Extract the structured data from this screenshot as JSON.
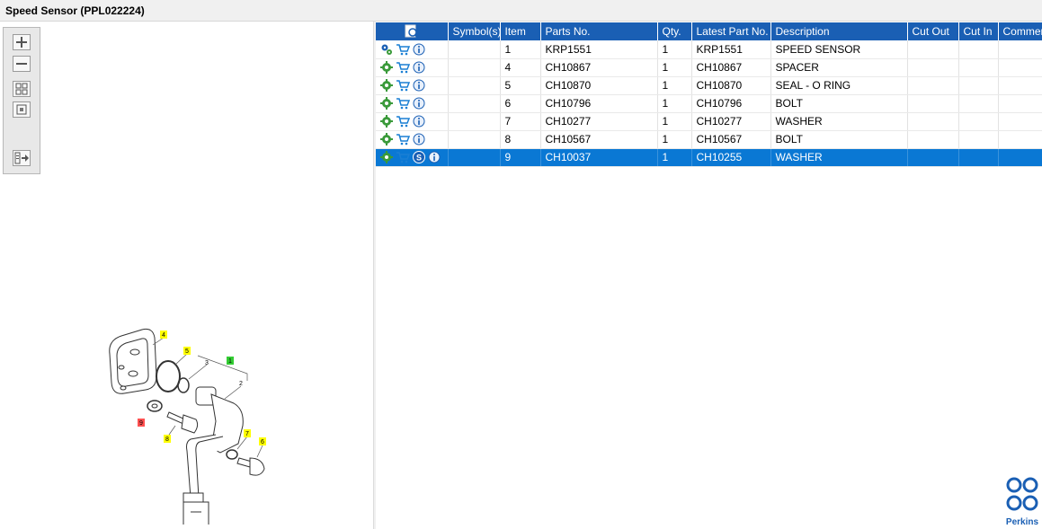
{
  "window": {
    "title": "Speed Sensor (PPL022224)"
  },
  "toolbar": {
    "tools": [
      {
        "name": "zoom-in-icon"
      },
      {
        "name": "zoom-out-icon"
      },
      {
        "name": "fit-all-icon"
      },
      {
        "name": "actual-size-icon"
      },
      {
        "name": "export-icon"
      }
    ]
  },
  "drawing": {
    "callouts": [
      {
        "label": "4",
        "color": "#ffff00"
      },
      {
        "label": "5",
        "color": "#ffff00"
      },
      {
        "label": "3",
        "color": ""
      },
      {
        "label": "1",
        "color": "#33cc33"
      },
      {
        "label": "2",
        "color": ""
      },
      {
        "label": "9",
        "color": "#ff5050"
      },
      {
        "label": "8",
        "color": "#ffff00"
      },
      {
        "label": "7",
        "color": "#ffff00"
      },
      {
        "label": "6",
        "color": "#ffff00"
      }
    ]
  },
  "table": {
    "columns": [
      "",
      "Symbol(s)",
      "Item",
      "Parts No.",
      "Qty.",
      "Latest Part No.",
      "Description",
      "Cut Out",
      "Cut In",
      "Comment"
    ],
    "rows": [
      {
        "icons": [
          "gears-icon",
          "cart-icon",
          "info-icon"
        ],
        "symbols": "",
        "item": "1",
        "part_no": "KRP1551",
        "qty": "1",
        "latest_part_no": "KRP1551",
        "description": "SPEED SENSOR",
        "cut_out": "",
        "cut_in": "",
        "comment": "",
        "selected": false
      },
      {
        "icons": [
          "gear-icon",
          "cart-icon",
          "info-icon"
        ],
        "symbols": "",
        "item": "4",
        "part_no": "CH10867",
        "qty": "1",
        "latest_part_no": "CH10867",
        "description": "SPACER",
        "cut_out": "",
        "cut_in": "",
        "comment": "",
        "selected": false
      },
      {
        "icons": [
          "gear-icon",
          "cart-icon",
          "info-icon"
        ],
        "symbols": "",
        "item": "5",
        "part_no": "CH10870",
        "qty": "1",
        "latest_part_no": "CH10870",
        "description": "SEAL - O RING",
        "cut_out": "",
        "cut_in": "",
        "comment": "",
        "selected": false
      },
      {
        "icons": [
          "gear-icon",
          "cart-icon",
          "info-icon"
        ],
        "symbols": "",
        "item": "6",
        "part_no": "CH10796",
        "qty": "1",
        "latest_part_no": "CH10796",
        "description": "BOLT",
        "cut_out": "",
        "cut_in": "",
        "comment": "",
        "selected": false
      },
      {
        "icons": [
          "gear-icon",
          "cart-icon",
          "info-icon"
        ],
        "symbols": "",
        "item": "7",
        "part_no": "CH10277",
        "qty": "1",
        "latest_part_no": "CH10277",
        "description": "WASHER",
        "cut_out": "",
        "cut_in": "",
        "comment": "",
        "selected": false
      },
      {
        "icons": [
          "gear-icon",
          "cart-icon",
          "info-icon"
        ],
        "symbols": "",
        "item": "8",
        "part_no": "CH10567",
        "qty": "1",
        "latest_part_no": "CH10567",
        "description": "BOLT",
        "cut_out": "",
        "cut_in": "",
        "comment": "",
        "selected": false
      },
      {
        "icons": [
          "gear-icon",
          "cart-icon",
          "supersession-icon",
          "info-icon"
        ],
        "symbols": "",
        "item": "9",
        "part_no": "CH10037",
        "qty": "1",
        "latest_part_no": "CH10255",
        "description": "WASHER",
        "cut_out": "",
        "cut_in": "",
        "comment": "",
        "selected": true
      }
    ]
  },
  "supersession_glyph": "S",
  "logo": {
    "text": "Perkins",
    "color": "#1a5fb4"
  },
  "colors": {
    "header": "#1a5fb4",
    "selected_row": "#0a78d4"
  }
}
